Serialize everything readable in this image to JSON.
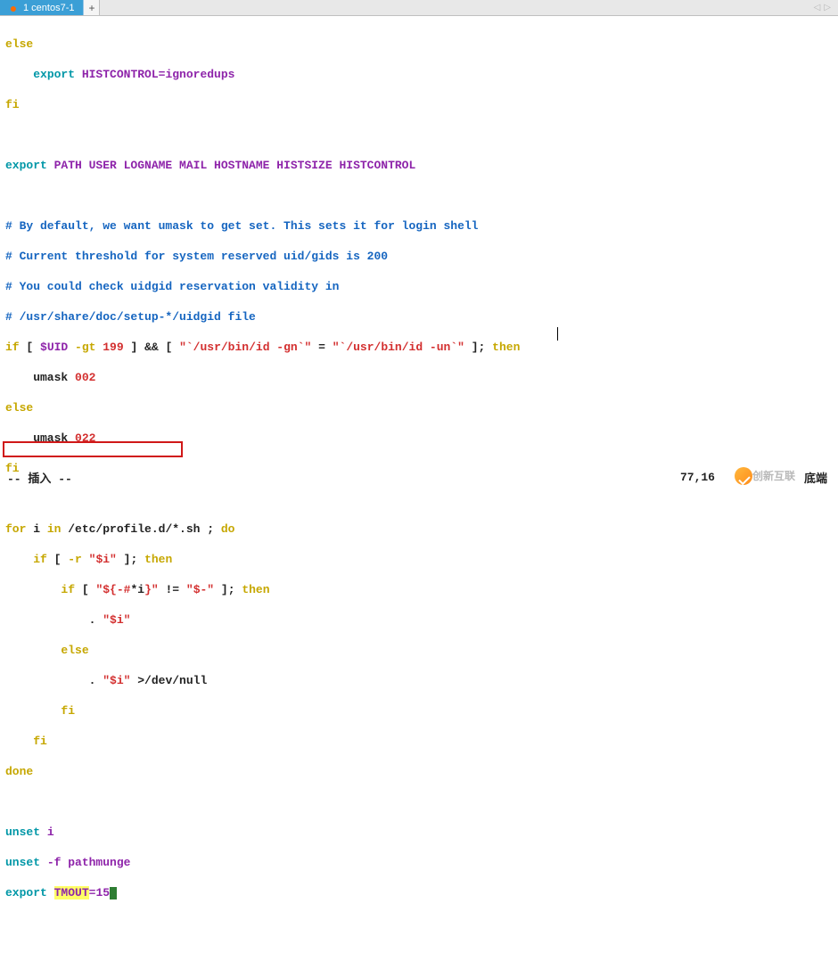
{
  "tabbar": {
    "active_tab_label": "1 centos7-1",
    "add_tab_glyph": "+",
    "nav_left_glyph": "◁",
    "nav_right_glyph": "▷"
  },
  "code": {
    "l1_else": "else",
    "l2_pad": "    ",
    "l2_export": "export",
    "l2_rest": " HISTCONTROL=ignoredups",
    "l3_fi": "fi",
    "l5_export": "export",
    "l5_rest": " PATH USER LOGNAME MAIL HOSTNAME HISTSIZE HISTCONTROL",
    "c1": "# By default, we want umask to get set. This sets it for login shell",
    "c2": "# Current threshold for system reserved uid/gids is 200",
    "c3": "# You could check uidgid reservation validity in",
    "c4": "# /usr/share/doc/setup-*/uidgid file",
    "if1_if": "if",
    "if1_lb": " [ ",
    "if1_uid": "$UID",
    "if1_gt": " -gt ",
    "if1_199": "199",
    "if1_rb": " ] ",
    "if1_and": "&&",
    "if1_lb2": " [ ",
    "if1_s1": "\"`/usr/bin/id -gn`\"",
    "if1_eq": " = ",
    "if1_s2": "\"`/usr/bin/id -un`\"",
    "if1_rb2": " ]; ",
    "if1_then": "then",
    "um1_pad": "    umask ",
    "um1_val": "002",
    "if1_else": "else",
    "um2_pad": "    umask ",
    "um2_val": "022",
    "if1_fi": "fi",
    "for_for": "for",
    "for_i": " i ",
    "for_in": "in",
    "for_path": " /etc/profile.d/*.sh ; ",
    "for_do": "do",
    "b1_pad": "    ",
    "b1_if": "if",
    "b1_lb": " [ ",
    "b1_r": "-r ",
    "b1_s": "\"$i\"",
    "b1_rb": " ]; ",
    "b1_then": "then",
    "b2_pad": "        ",
    "b2_if": "if",
    "b2_lb": " [ ",
    "b2_s1a": "\"${-#",
    "b2_s1i": "*i",
    "b2_s1b": "}\"",
    "b2_neq": " != ",
    "b2_s2": "\"$-\"",
    "b2_rb": " ]; ",
    "b2_then": "then",
    "b3_pad": "            . ",
    "b3_s": "\"$i\"",
    "b4_pad": "        ",
    "b4_else": "else",
    "b5_pad": "            . ",
    "b5_s": "\"$i\"",
    "b5_tail": " >/dev/null",
    "b6_pad": "        ",
    "b6_fi": "fi",
    "b7_pad": "    ",
    "b7_fi": "fi",
    "done": "done",
    "u1_unset": "unset",
    "u1_rest": " i",
    "u2_unset": "unset",
    "u2_rest": " -f pathmunge",
    "ex_export": "export",
    "ex_sp": " ",
    "ex_tmout": "TMOUT",
    "ex_val": "=15"
  },
  "status": {
    "mode": "-- 插入 --",
    "position": "77,16",
    "right": "底端",
    "watermark": "创新互联"
  }
}
